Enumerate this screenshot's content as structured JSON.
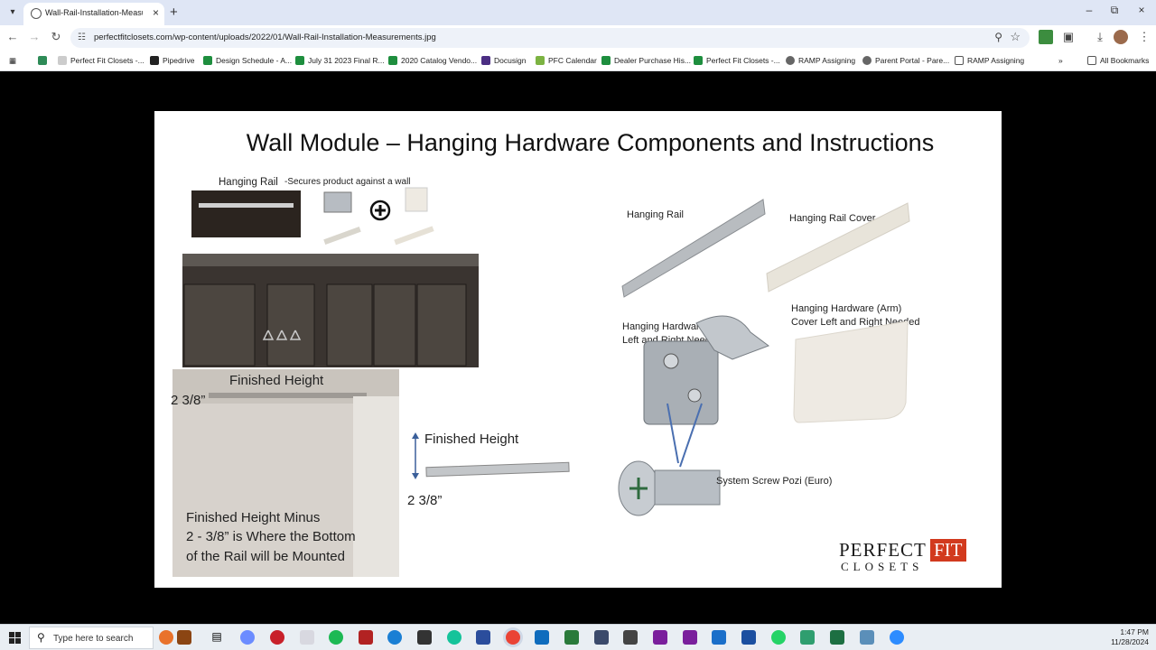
{
  "browser": {
    "tab_title": "Wall-Rail-Installation-Measurem",
    "url": "perfectfitclosets.com/wp-content/uploads/2022/01/Wall-Rail-Installation-Measurements.jpg",
    "bookmarks": [
      {
        "label": "Perfect Fit Closets -...",
        "color": "#2e8b57"
      },
      {
        "label": "Pipedrive",
        "color": "#222222"
      },
      {
        "label": "Design Schedule - A...",
        "color": "#1e8e3e"
      },
      {
        "label": "July 31 2023 Final R...",
        "color": "#1e8e3e"
      },
      {
        "label": "2020 Catalog Vendo...",
        "color": "#1e8e3e"
      },
      {
        "label": "Docusign",
        "color": "#4b2e83"
      },
      {
        "label": "PFC Calendar",
        "color": "#7cb342"
      },
      {
        "label": "Dealer Purchase His...",
        "color": "#1e8e3e"
      },
      {
        "label": "Perfect Fit Closets -...",
        "color": "#1e8e3e"
      },
      {
        "label": "RAMP Assigning",
        "color": "#555555"
      },
      {
        "label": "Parent Portal - Pare...",
        "color": "#555555"
      },
      {
        "label": "RAMP Assigning",
        "color": "#555555"
      }
    ],
    "all_bookmarks": "All Bookmarks"
  },
  "slide": {
    "title": "Wall Module – Hanging Hardware Components and Instructions",
    "hanging_rail_top": "Hanging Rail",
    "secures_note": "-Secures product against a wall",
    "finished_height_top": "Finished Height",
    "measure_left": "2 3/8”",
    "finished_height_right": "Finished Height",
    "measure_right": "2 3/8”",
    "minus_note_1": "Finished Height Minus",
    "minus_note_2": "2 - 3/8”  is Where the Bottom",
    "minus_note_3": "of the Rail will be Mounted",
    "hanging_rail": "Hanging Rail",
    "hanging_rail_cover": "Hanging Rail Cover",
    "hardware_arm_1": "Hanging Hardware (Arm)",
    "hardware_arm_2": "Left and Right Needed",
    "hardware_cover_1": "Hanging Hardware (Arm)",
    "hardware_cover_2": "Cover Left and Right Needed",
    "screw": "System Screw Pozi (Euro)",
    "logo_word_1": "PERFECT",
    "logo_word_2": "FIT",
    "logo_word_3": "CLOSETS"
  },
  "taskbar": {
    "search_placeholder": "Type here to search",
    "time": "1:47 PM",
    "date": "11/28/2024"
  }
}
